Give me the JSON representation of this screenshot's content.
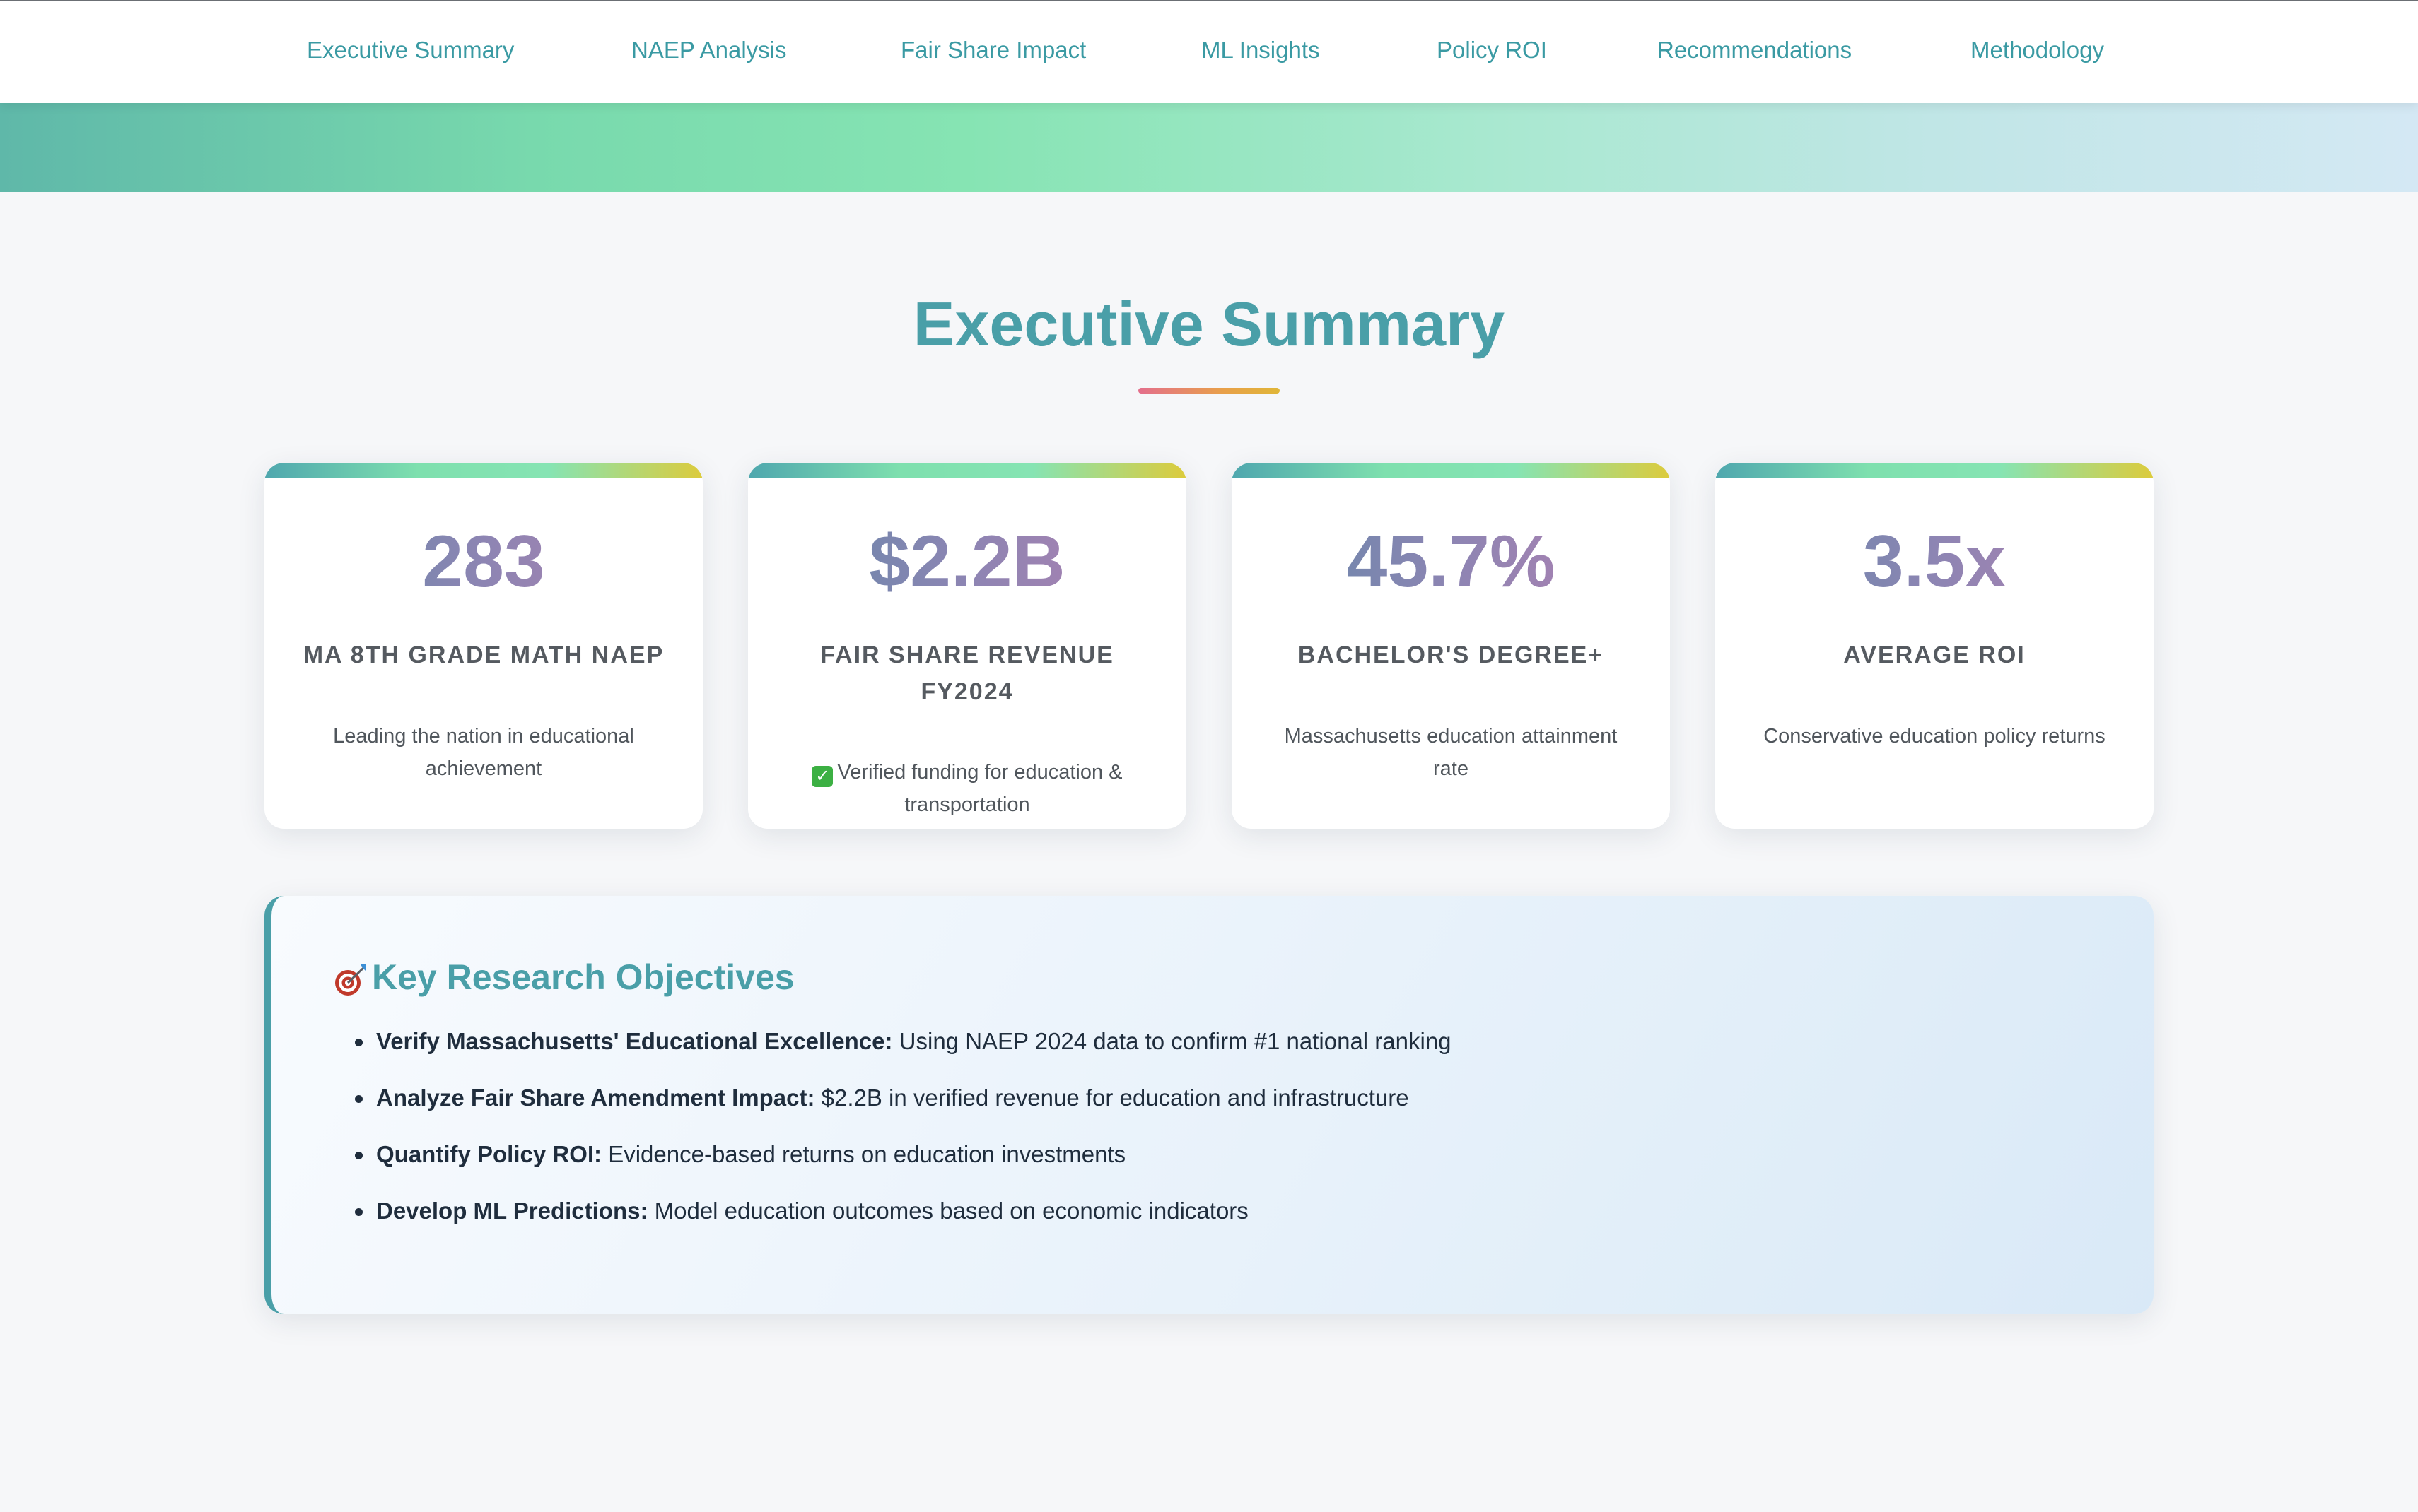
{
  "nav": {
    "items": [
      {
        "label": "Executive Summary"
      },
      {
        "label": "NAEP Analysis"
      },
      {
        "label": "Fair Share Impact"
      },
      {
        "label": "ML Insights"
      },
      {
        "label": "Policy ROI"
      },
      {
        "label": "Recommendations"
      },
      {
        "label": "Methodology"
      }
    ]
  },
  "section": {
    "title": "Executive Summary"
  },
  "metrics": [
    {
      "value": "283",
      "label": "MA 8TH GRADE MATH NAEP",
      "description": "Leading the nation in educational achievement"
    },
    {
      "value": "$2.2B",
      "label": "FAIR SHARE REVENUE FY2024",
      "check": "✓",
      "description": "Verified funding for education & transportation"
    },
    {
      "value": "45.7%",
      "label": "BACHELOR'S DEGREE+",
      "description": "Massachusetts education attainment rate"
    },
    {
      "value": "3.5x",
      "label": "AVERAGE ROI",
      "description": "Conservative education policy returns"
    }
  ],
  "objectives": {
    "icon": "target-icon",
    "title": "Key Research Objectives",
    "items": [
      {
        "bold": "Verify Massachusetts' Educational Excellence:",
        "text": " Using NAEP 2024 data to confirm #1 national ranking"
      },
      {
        "bold": "Analyze Fair Share Amendment Impact:",
        "text": " $2.2B in verified revenue for education and infrastructure"
      },
      {
        "bold": "Quantify Policy ROI:",
        "text": " Evidence-based returns on education investments"
      },
      {
        "bold": "Develop ML Predictions:",
        "text": " Model education outcomes based on economic indicators"
      }
    ]
  },
  "colors": {
    "accent": "#4a9fa8",
    "nav_link": "#3a9aa3",
    "success": "#3cb043"
  }
}
